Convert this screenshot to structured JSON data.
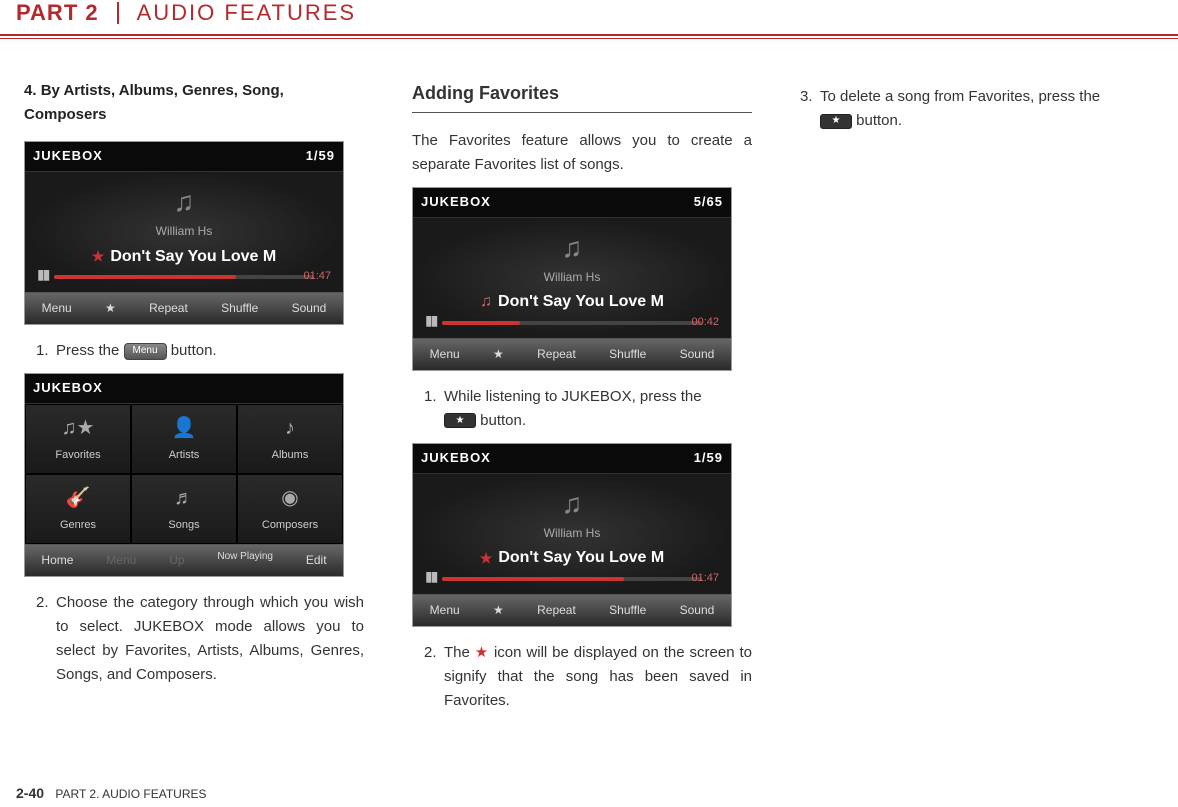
{
  "header": {
    "part": "PART 2",
    "title": "AUDIO FEATURES"
  },
  "col1": {
    "heading_num": "4.",
    "heading_text": "By Artists, Albums, Genres, Song, Composers",
    "ss1": {
      "top": "JUKEBOX",
      "count": "1/59",
      "artist": "William Hs",
      "title": "Don't Say You Love M",
      "time": "01:47",
      "menu": [
        "Menu",
        "★",
        "Repeat",
        "Shuffle",
        "Sound"
      ]
    },
    "step1_num": "1.",
    "step1_a": "Press the ",
    "step1_btn": "Menu",
    "step1_b": " button.",
    "ss2": {
      "top": "JUKEBOX",
      "cells": [
        "Favorites",
        "Artists",
        "Albums",
        "Genres",
        "Songs",
        "Composers"
      ],
      "menu": [
        "Home",
        "Menu",
        "Up",
        "Now Playing",
        "Edit"
      ]
    },
    "step2_num": "2.",
    "step2_text": "Choose the category through which you wish to select. JUKEBOX mode allows you to select by Favorites, Artists, Albums, Genres, Songs, and Composers."
  },
  "col2": {
    "heading": "Adding Favorites",
    "intro": "The Favorites feature allows you to create a separate Favorites list of songs.",
    "ss1": {
      "top": "JUKEBOX",
      "count": "5/65",
      "artist": "William Hs",
      "title": "Don't Say You Love M",
      "time": "00:42",
      "menu": [
        "Menu",
        "★",
        "Repeat",
        "Shuffle",
        "Sound"
      ]
    },
    "step1_num": "1.",
    "step1_a": "While listening to JUKEBOX, press the ",
    "step1_b": " button.",
    "ss2": {
      "top": "JUKEBOX",
      "count": "1/59",
      "artist": "William Hs",
      "title": "Don't Say You Love M",
      "time": "01:47",
      "menu": [
        "Menu",
        "★",
        "Repeat",
        "Shuffle",
        "Sound"
      ]
    },
    "step2_num": "2.",
    "step2_a": "The ",
    "step2_b": " icon will be displayed on the screen to signify that the song has been saved in Favorites."
  },
  "col3": {
    "step3_num": "3.",
    "step3_a": "To delete a song from Favorites, press the ",
    "step3_b": " button."
  },
  "footer": {
    "page": "2-40",
    "label": "PART 2. AUDIO FEATURES"
  }
}
